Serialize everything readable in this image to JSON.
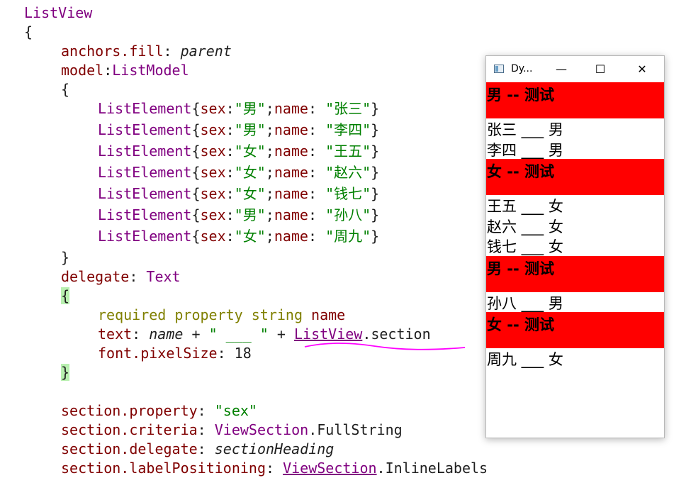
{
  "code": {
    "l1": "ListView",
    "l2": "{",
    "l3_prop": "anchors.fill",
    "l3_colon": ": ",
    "l3_val": "parent",
    "l4_prop": "model",
    "l4_colon": ":",
    "l4_type": "ListModel",
    "l5": "{",
    "elements": [
      {
        "sex": "男",
        "name": "张三"
      },
      {
        "sex": "男",
        "name": "李四"
      },
      {
        "sex": "女",
        "name": "王五"
      },
      {
        "sex": "女",
        "name": "赵六"
      },
      {
        "sex": "女",
        "name": "钱七"
      },
      {
        "sex": "男",
        "name": "孙八"
      },
      {
        "sex": "女",
        "name": "周九"
      }
    ],
    "list_element_kw": "ListElement",
    "l13": "}",
    "l14_prop": "delegate",
    "l14_type": "Text",
    "l15": "{",
    "l16_req": "required property string",
    "l16_name": " name",
    "l17_prop": "text",
    "l17_a": "name",
    "l17_b": " + ",
    "l17_str": "\" ___ \"",
    "l17_c": " + ",
    "l17_lv": "ListView",
    "l17_sec": ".section",
    "l18_prop": "font.pixelSize",
    "l18_val": "18",
    "l19": "}",
    "l21_prop": "section.property",
    "l21_val": "\"sex\"",
    "l22_prop": "section.criteria",
    "l22_type": "ViewSection",
    "l22_val": ".FullString",
    "l23_prop": "section.delegate",
    "l23_val": "sectionHeading",
    "l24_prop": "section.labelPositioning",
    "l24_type": "ViewSection",
    "l24_val": ".InlineLabels"
  },
  "window": {
    "title": "Dy...",
    "minimize": "—",
    "maximize": "☐",
    "close": "✕",
    "sections": [
      {
        "heading": "男 -- 测试",
        "items": [
          "张三 ___ 男",
          "李四 ___ 男"
        ]
      },
      {
        "heading": "女 -- 测试",
        "items": [
          "王五 ___ 女",
          "赵六 ___ 女",
          "钱七 ___ 女"
        ]
      },
      {
        "heading": "男 -- 测试",
        "items": [
          "孙八 ___ 男"
        ]
      },
      {
        "heading": "女 -- 测试",
        "items": [
          "周九 ___ 女"
        ]
      }
    ],
    "colors": {
      "section_bg": "#ff0000"
    }
  }
}
